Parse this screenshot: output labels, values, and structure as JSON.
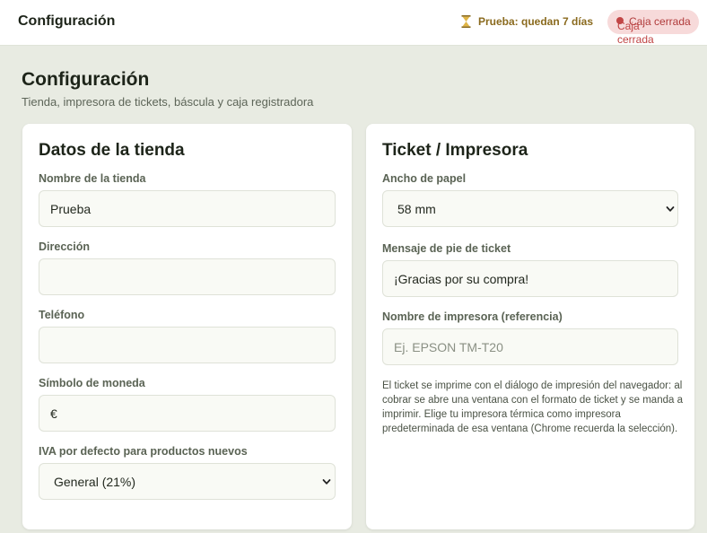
{
  "topbar": {
    "title": "Configuración",
    "trial": "Prueba: quedan 7 días",
    "status": "Caja cerrada",
    "status_overflow": "Caja cerrada"
  },
  "page": {
    "title": "Configuración",
    "subtitle": "Tienda, impresora de tickets, báscula y caja registradora"
  },
  "store": {
    "title": "Datos de la tienda",
    "name_label": "Nombre de la tienda",
    "name_value": "Prueba",
    "address_label": "Dirección",
    "address_value": "",
    "phone_label": "Teléfono",
    "phone_value": "",
    "currency_label": "Símbolo de moneda",
    "currency_value": "€",
    "vat_label": "IVA por defecto para productos nuevos",
    "vat_value": "General (21%)"
  },
  "ticket": {
    "title": "Ticket / Impresora",
    "paper_label": "Ancho de papel",
    "paper_value": "58 mm",
    "footer_label": "Mensaje de pie de ticket",
    "footer_value": "¡Gracias por su compra!",
    "printer_label": "Nombre de impresora (referencia)",
    "printer_placeholder": "Ej. EPSON TM-T20",
    "help": "El ticket se imprime con el diálogo de impresión del navegador: al cobrar se abre una ventana con el formato de ticket y se manda a imprimir. Elige tu impresora térmica como impresora predeterminada de esa ventana (Chrome recuerda la selección)."
  },
  "icons": {
    "trial": "hourglass-icon",
    "status": "status-dot-icon",
    "select": "chevron-down-icon"
  },
  "colors": {
    "background": "#e8ebe2",
    "trial_text": "#8a6a1e",
    "status_bg": "#f7dada",
    "status_text": "#b03a3a"
  }
}
